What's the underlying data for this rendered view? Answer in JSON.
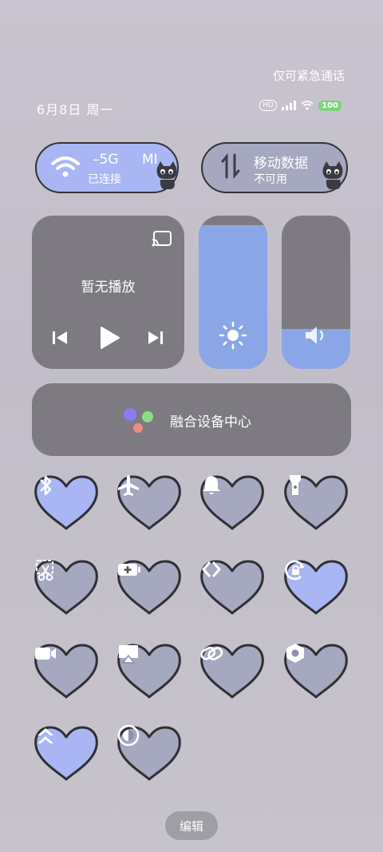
{
  "header": {
    "emergency_text": "仅可紧急通话",
    "date_text": "6月8日 周一",
    "battery_text": "100"
  },
  "wifi_tile": {
    "name": "–5G",
    "name_suffix": "MI",
    "status": "已连接",
    "active": true
  },
  "data_tile": {
    "name": "移动数据",
    "status": "不可用",
    "active": false
  },
  "media": {
    "status": "暂无播放"
  },
  "brightness": {
    "level": 0.94
  },
  "volume": {
    "level": 0.26
  },
  "device_hub": {
    "label": "融合设备中心"
  },
  "toggles": [
    {
      "name": "bluetooth",
      "icon": "bluetooth-icon",
      "active": true
    },
    {
      "name": "airplane-mode",
      "icon": "airplane-icon",
      "active": false
    },
    {
      "name": "bell",
      "icon": "bell-icon",
      "active": false
    },
    {
      "name": "flashlight",
      "icon": "flashlight-icon",
      "active": false
    },
    {
      "name": "screenshot",
      "icon": "scissors-icon",
      "active": false
    },
    {
      "name": "battery-saver",
      "icon": "battery-plus-icon",
      "active": false
    },
    {
      "name": "nearby-share",
      "icon": "chevrons-icon",
      "active": false
    },
    {
      "name": "rotation-lock",
      "icon": "rotate-lock-icon",
      "active": true
    },
    {
      "name": "screen-record",
      "icon": "video-camera-icon",
      "active": false
    },
    {
      "name": "screen-cast",
      "icon": "cast-screen-icon",
      "active": false
    },
    {
      "name": "link",
      "icon": "link-icon",
      "active": false
    },
    {
      "name": "settings",
      "icon": "hex-settings-icon",
      "active": false
    },
    {
      "name": "performance",
      "icon": "double-chevron-up-icon",
      "active": true
    },
    {
      "name": "dark-mode",
      "icon": "contrast-icon",
      "active": false
    }
  ],
  "edit_label": "编辑",
  "colors": {
    "active": "#a9b6f3",
    "inactive": "#a5a8bf",
    "card": "#7d7b81",
    "slider_fill": "#8aa6e6"
  }
}
